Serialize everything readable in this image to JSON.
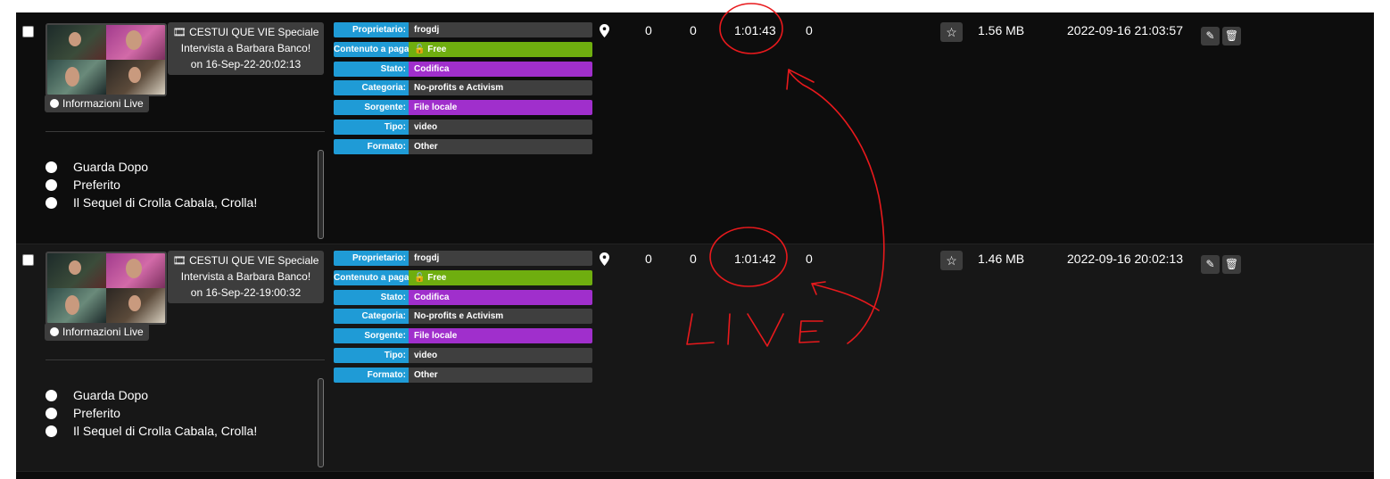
{
  "rows": [
    {
      "title_line1": "🎞 CESTUI QUE VIE Speciale",
      "title_line2": "Intervista a Barbara Banco!",
      "title_line3": "on 16-Sep-22-20:02:13",
      "info_button": "Informazioni Live",
      "playlists": [
        "Guarda Dopo",
        "Preferito",
        "Il Sequel di Crolla Cabala, Crolla!"
      ],
      "meta": [
        {
          "label": "Proprietario:",
          "value": "frogdj",
          "color": "gray"
        },
        {
          "label": "Contenuto a paga",
          "value": "🔓 Free",
          "color": "green"
        },
        {
          "label": "Stato:",
          "value": "Codifica",
          "color": "purple"
        },
        {
          "label": "Categoria:",
          "value": "No-profits e Activism",
          "color": "gray"
        },
        {
          "label": "Sorgente:",
          "value": "File locale",
          "color": "purple"
        },
        {
          "label": "Tipo:",
          "value": "video",
          "color": "gray"
        },
        {
          "label": "Formato:",
          "value": "Other",
          "color": "gray"
        }
      ],
      "views": "0",
      "likes": "0",
      "duration": "1:01:43",
      "comments": "0",
      "size": "1.56 MB",
      "date": "2022-09-16 21:03:57"
    },
    {
      "title_line1": "🎞 CESTUI QUE VIE Speciale",
      "title_line2": "Intervista a Barbara Banco!",
      "title_line3": "on 16-Sep-22-19:00:32",
      "info_button": "Informazioni Live",
      "playlists": [
        "Guarda Dopo",
        "Preferito",
        "Il Sequel di Crolla Cabala, Crolla!"
      ],
      "meta": [
        {
          "label": "Proprietario:",
          "value": "frogdj",
          "color": "gray"
        },
        {
          "label": "Contenuto a paga",
          "value": "🔓 Free",
          "color": "green"
        },
        {
          "label": "Stato:",
          "value": "Codifica",
          "color": "purple"
        },
        {
          "label": "Categoria:",
          "value": "No-profits e Activism",
          "color": "gray"
        },
        {
          "label": "Sorgente:",
          "value": "File locale",
          "color": "purple"
        },
        {
          "label": "Tipo:",
          "value": "video",
          "color": "gray"
        },
        {
          "label": "Formato:",
          "value": "Other",
          "color": "gray"
        }
      ],
      "views": "0",
      "likes": "0",
      "duration": "1:01:42",
      "comments": "0",
      "size": "1.46 MB",
      "date": "2022-09-16 20:02:13"
    }
  ],
  "annotation": {
    "text": "LIVE",
    "color": "#e8191c"
  },
  "colors": {
    "label_blue": "#1f9bd6",
    "gray": "#3f3f3f",
    "green": "#6fae0f",
    "purple": "#a02fcc",
    "panel": "#0d0d0d"
  },
  "icons": [
    "checkbox-icon",
    "map-pin-icon",
    "star-icon",
    "edit-icon",
    "trash-icon",
    "film-icon",
    "unlock-icon"
  ]
}
